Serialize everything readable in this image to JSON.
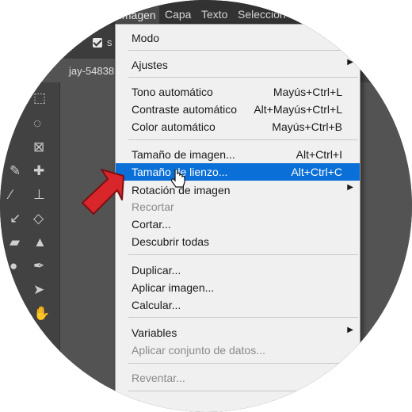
{
  "menubar": {
    "items": [
      "Imagen",
      "Capa",
      "Texto",
      "Selección"
    ]
  },
  "options": {
    "checkbox_label": "s"
  },
  "document": {
    "tab_label": "jay-54838"
  },
  "image_menu": {
    "items": [
      {
        "label": "Modo",
        "shortcut": "",
        "submenu": false,
        "disabled": false
      },
      {
        "label": "Ajustes",
        "shortcut": "",
        "submenu": true,
        "disabled": false
      },
      {
        "label": "Tono automático",
        "shortcut": "Mayús+Ctrl+L",
        "submenu": false,
        "disabled": false
      },
      {
        "label": "Contraste automático",
        "shortcut": "Alt+Mayús+Ctrl+L",
        "submenu": false,
        "disabled": false
      },
      {
        "label": "Color automático",
        "shortcut": "Mayús+Ctrl+B",
        "submenu": false,
        "disabled": false
      },
      {
        "label": "Tamaño de imagen...",
        "shortcut": "Alt+Ctrl+I",
        "submenu": false,
        "disabled": false
      },
      {
        "label": "Tamaño de lienzo...",
        "shortcut": "Alt+Ctrl+C",
        "submenu": false,
        "disabled": false,
        "highlighted": true
      },
      {
        "label": "Rotación de imagen",
        "shortcut": "",
        "submenu": true,
        "disabled": false
      },
      {
        "label": "Recortar",
        "shortcut": "",
        "submenu": false,
        "disabled": true
      },
      {
        "label": "Cortar...",
        "shortcut": "",
        "submenu": false,
        "disabled": false
      },
      {
        "label": "Descubrir todas",
        "shortcut": "",
        "submenu": false,
        "disabled": false
      },
      {
        "label": "Duplicar...",
        "shortcut": "",
        "submenu": false,
        "disabled": false
      },
      {
        "label": "Aplicar imagen...",
        "shortcut": "",
        "submenu": false,
        "disabled": false
      },
      {
        "label": "Calcular...",
        "shortcut": "",
        "submenu": false,
        "disabled": false
      },
      {
        "label": "Variables",
        "shortcut": "",
        "submenu": true,
        "disabled": false
      },
      {
        "label": "Aplicar conjunto de datos...",
        "shortcut": "",
        "submenu": false,
        "disabled": true
      },
      {
        "label": "Reventar...",
        "shortcut": "",
        "submenu": false,
        "disabled": true
      }
    ]
  },
  "colors": {
    "highlight": "#0a6fd7",
    "menu_bg": "#f0f0f0",
    "workspace": "#535353",
    "annotation_arrow": "#d9262a"
  }
}
